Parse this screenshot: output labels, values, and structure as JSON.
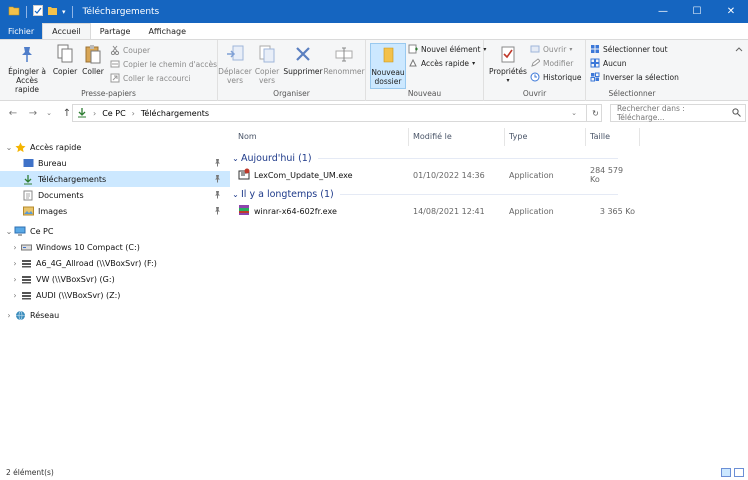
{
  "window": {
    "title": "Téléchargements",
    "controls": [
      "minimize-icon",
      "maximize-icon",
      "close-icon"
    ]
  },
  "tabs": [
    "Fichier",
    "Accueil",
    "Partage",
    "Affichage"
  ],
  "ribbon": {
    "presse_papiers": {
      "label": "Presse-papiers",
      "pin": "Épingler à\nAccès rapide",
      "copy": "Copier",
      "paste": "Coller",
      "cut": "Couper",
      "copy_path": "Copier le chemin d'accès",
      "paste_shortcut": "Coller le raccourci"
    },
    "organiser": {
      "label": "Organiser",
      "move": "Déplacer\nvers",
      "copy_to": "Copier\nvers",
      "delete": "Supprimer",
      "rename": "Renommer"
    },
    "nouveau": {
      "label": "Nouveau",
      "new_folder": "Nouveau\ndossier",
      "new_item": "Nouvel élément",
      "easy_access": "Accès rapide"
    },
    "ouvrir": {
      "label": "Ouvrir",
      "properties": "Propriétés",
      "open": "Ouvrir",
      "modify": "Modifier",
      "history": "Historique"
    },
    "selectionner": {
      "label": "Sélectionner",
      "select_all": "Sélectionner tout",
      "select_none": "Aucun",
      "invert": "Inverser la sélection"
    }
  },
  "address": {
    "crumbs": [
      "Ce PC",
      "Téléchargements"
    ],
    "search_placeholder": "Rechercher dans : Télécharge..."
  },
  "sidebar": {
    "quick_access": "Accès rapide",
    "quick_items": [
      "Bureau",
      "Téléchargements",
      "Documents",
      "Images"
    ],
    "this_pc": "Ce PC",
    "drives": [
      "Windows 10 Compact  (C:)",
      "A6_4G_Allroad (\\\\VBoxSvr) (F:)",
      "VW (\\\\VBoxSvr) (G:)",
      "AUDI (\\\\VBoxSvr) (Z:)"
    ],
    "network": "Réseau"
  },
  "columns": {
    "name": "Nom",
    "modified": "Modifié le",
    "type": "Type",
    "size": "Taille"
  },
  "groups": [
    {
      "label": "Aujourd'hui (1)",
      "files": [
        {
          "name": "LexCom_Update_UM.exe",
          "modified": "01/10/2022 14:36",
          "type": "Application",
          "size": "284 579 Ko"
        }
      ]
    },
    {
      "label": "Il y a longtemps (1)",
      "files": [
        {
          "name": "winrar-x64-602fr.exe",
          "modified": "14/08/2021 12:41",
          "type": "Application",
          "size": "3 365 Ko"
        }
      ]
    }
  ],
  "status": {
    "count": "2 élément(s)"
  },
  "colors": {
    "accent": "#1565c0",
    "selection": "#cce8ff",
    "group_text": "#1e3a8a"
  }
}
